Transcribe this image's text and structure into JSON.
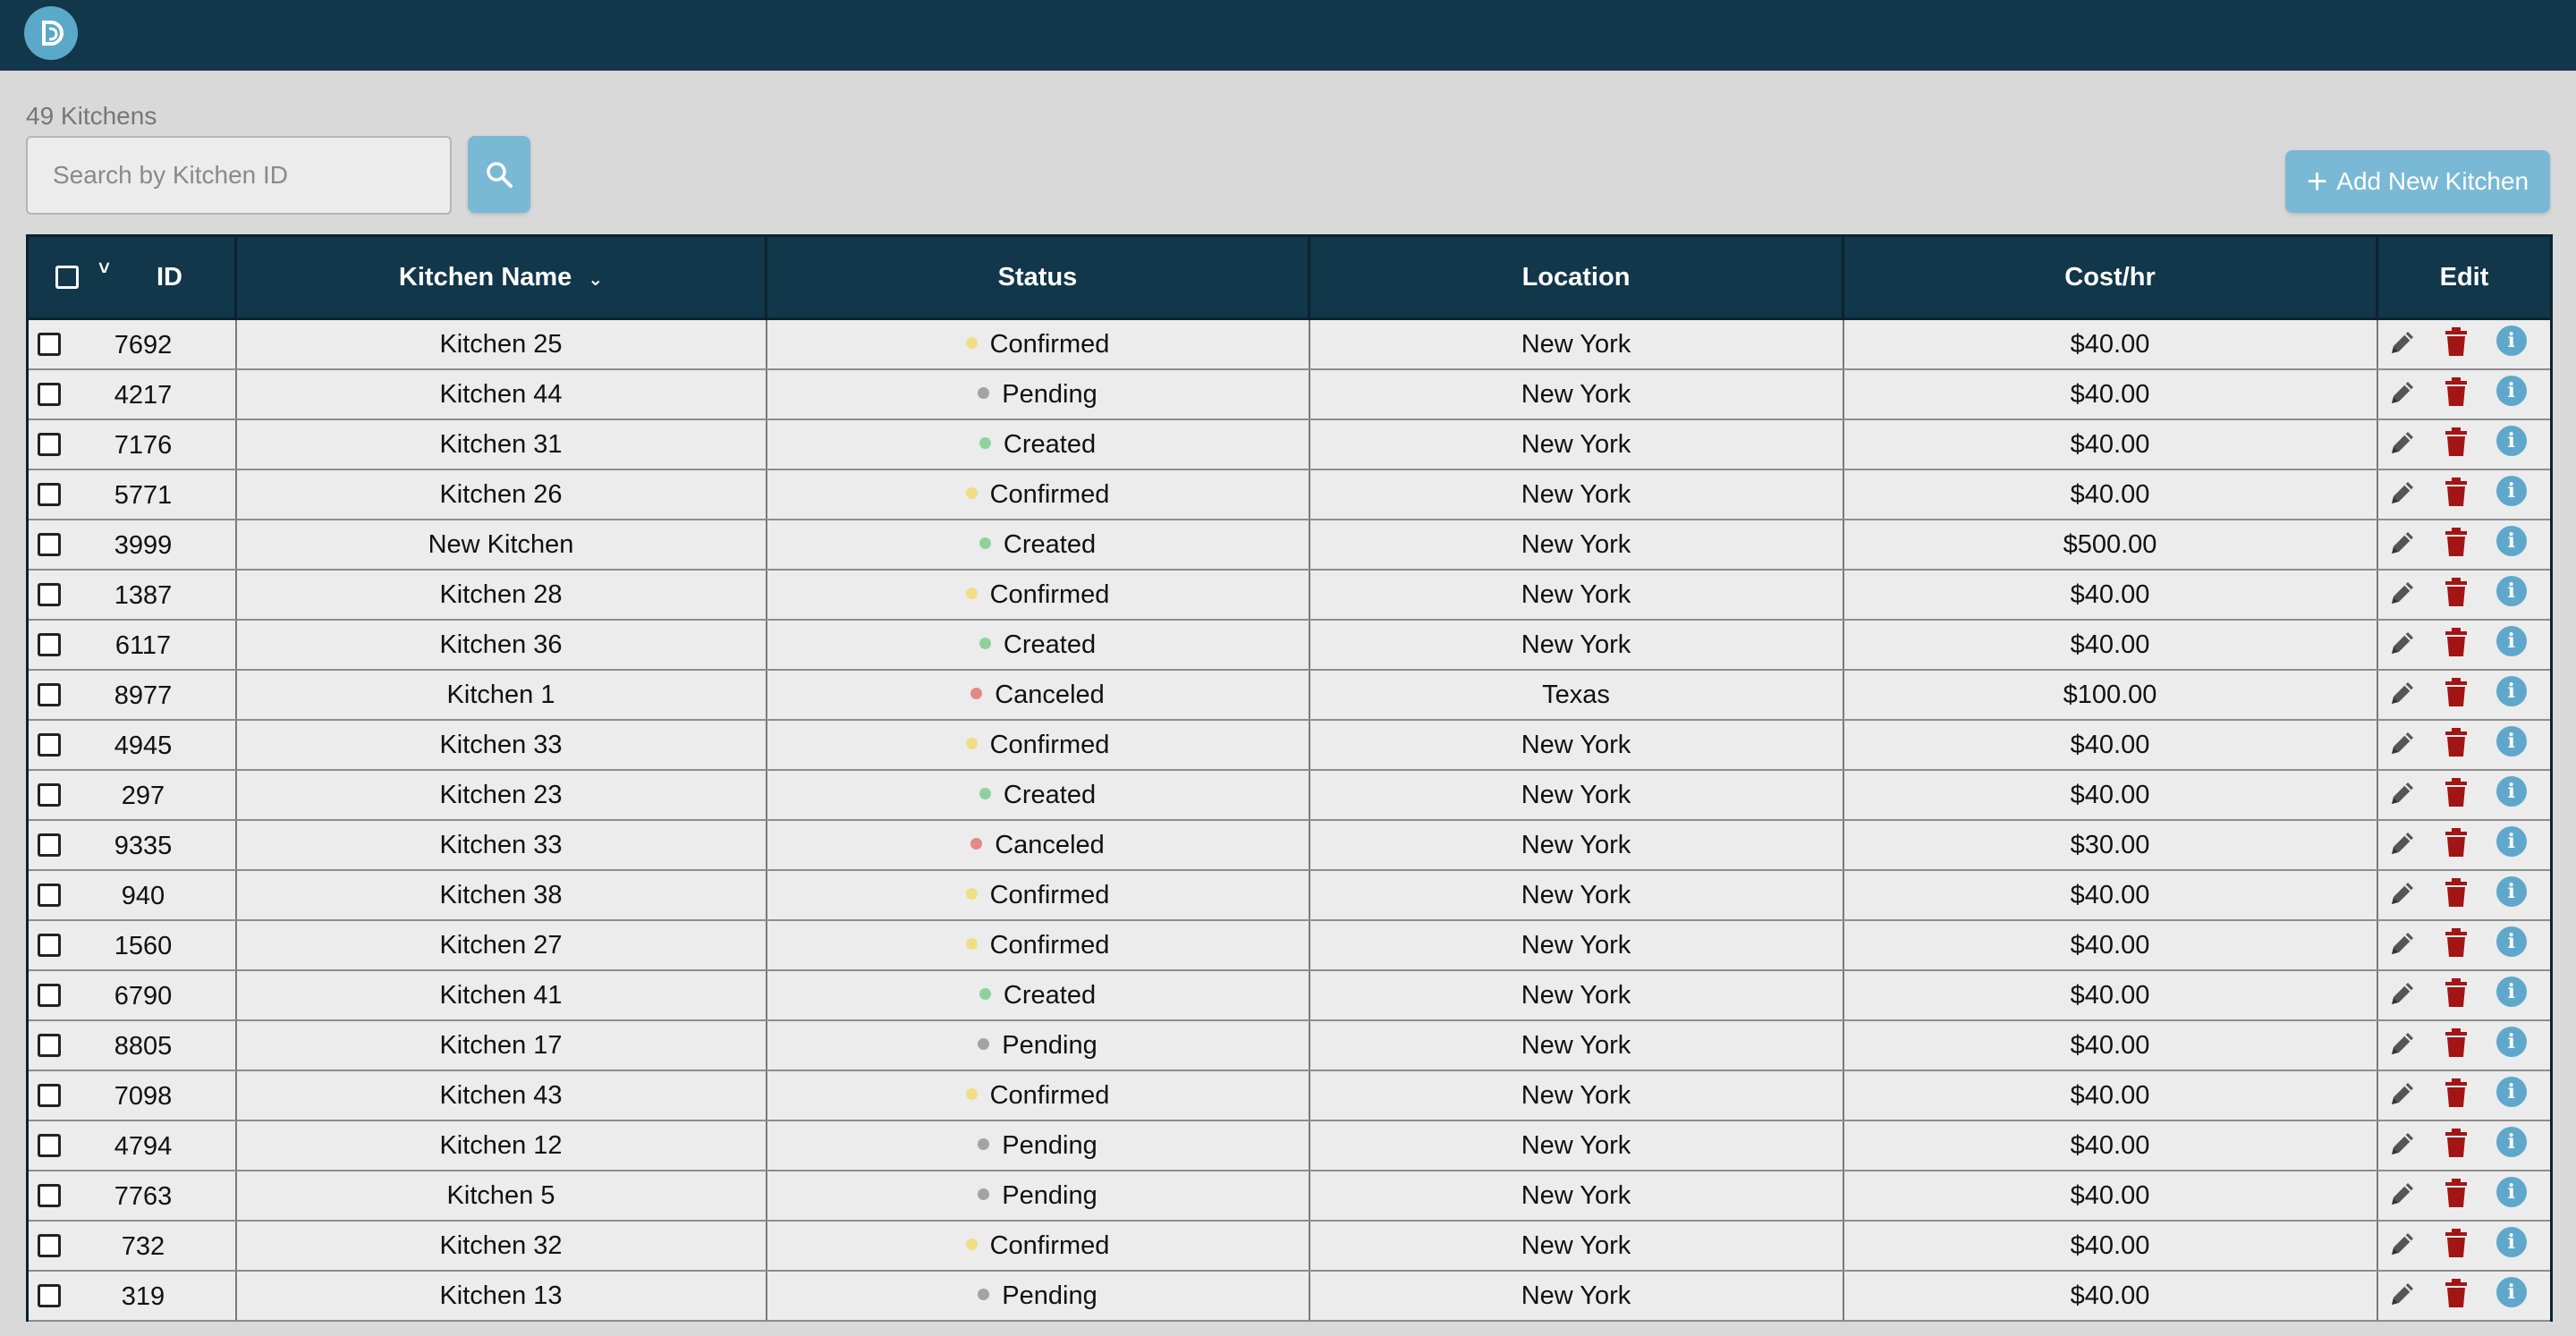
{
  "app": {
    "logo_letter": "D"
  },
  "summary": {
    "count_text": "49 Kitchens"
  },
  "search": {
    "placeholder": "Search by Kitchen ID",
    "value": ""
  },
  "actions": {
    "add_label": "Add New Kitchen"
  },
  "table": {
    "headers": {
      "id": "ID",
      "name": "Kitchen Name",
      "status": "Status",
      "location": "Location",
      "cost": "Cost/hr",
      "edit": "Edit"
    },
    "status_colors": {
      "Confirmed": "#f1dd84",
      "Pending": "#a3a3a3",
      "Created": "#8fd19e",
      "Canceled": "#e28a85"
    },
    "rows": [
      {
        "id": "7692",
        "name": "Kitchen 25",
        "status": "Confirmed",
        "location": "New York",
        "cost": "$40.00"
      },
      {
        "id": "4217",
        "name": "Kitchen 44",
        "status": "Pending",
        "location": "New York",
        "cost": "$40.00"
      },
      {
        "id": "7176",
        "name": "Kitchen 31",
        "status": "Created",
        "location": "New York",
        "cost": "$40.00"
      },
      {
        "id": "5771",
        "name": "Kitchen 26",
        "status": "Confirmed",
        "location": "New York",
        "cost": "$40.00"
      },
      {
        "id": "3999",
        "name": "New Kitchen",
        "status": "Created",
        "location": "New York",
        "cost": "$500.00"
      },
      {
        "id": "1387",
        "name": "Kitchen 28",
        "status": "Confirmed",
        "location": "New York",
        "cost": "$40.00"
      },
      {
        "id": "6117",
        "name": "Kitchen 36",
        "status": "Created",
        "location": "New York",
        "cost": "$40.00"
      },
      {
        "id": "8977",
        "name": "Kitchen 1",
        "status": "Canceled",
        "location": "Texas",
        "cost": "$100.00"
      },
      {
        "id": "4945",
        "name": "Kitchen 33",
        "status": "Confirmed",
        "location": "New York",
        "cost": "$40.00"
      },
      {
        "id": "297",
        "name": "Kitchen 23",
        "status": "Created",
        "location": "New York",
        "cost": "$40.00"
      },
      {
        "id": "9335",
        "name": "Kitchen 33",
        "status": "Canceled",
        "location": "New York",
        "cost": "$30.00"
      },
      {
        "id": "940",
        "name": "Kitchen 38",
        "status": "Confirmed",
        "location": "New York",
        "cost": "$40.00"
      },
      {
        "id": "1560",
        "name": "Kitchen 27",
        "status": "Confirmed",
        "location": "New York",
        "cost": "$40.00"
      },
      {
        "id": "6790",
        "name": "Kitchen 41",
        "status": "Created",
        "location": "New York",
        "cost": "$40.00"
      },
      {
        "id": "8805",
        "name": "Kitchen 17",
        "status": "Pending",
        "location": "New York",
        "cost": "$40.00"
      },
      {
        "id": "7098",
        "name": "Kitchen 43",
        "status": "Confirmed",
        "location": "New York",
        "cost": "$40.00"
      },
      {
        "id": "4794",
        "name": "Kitchen 12",
        "status": "Pending",
        "location": "New York",
        "cost": "$40.00"
      },
      {
        "id": "7763",
        "name": "Kitchen 5",
        "status": "Pending",
        "location": "New York",
        "cost": "$40.00"
      },
      {
        "id": "732",
        "name": "Kitchen 32",
        "status": "Confirmed",
        "location": "New York",
        "cost": "$40.00"
      },
      {
        "id": "319",
        "name": "Kitchen 13",
        "status": "Pending",
        "location": "New York",
        "cost": "$40.00"
      }
    ]
  }
}
